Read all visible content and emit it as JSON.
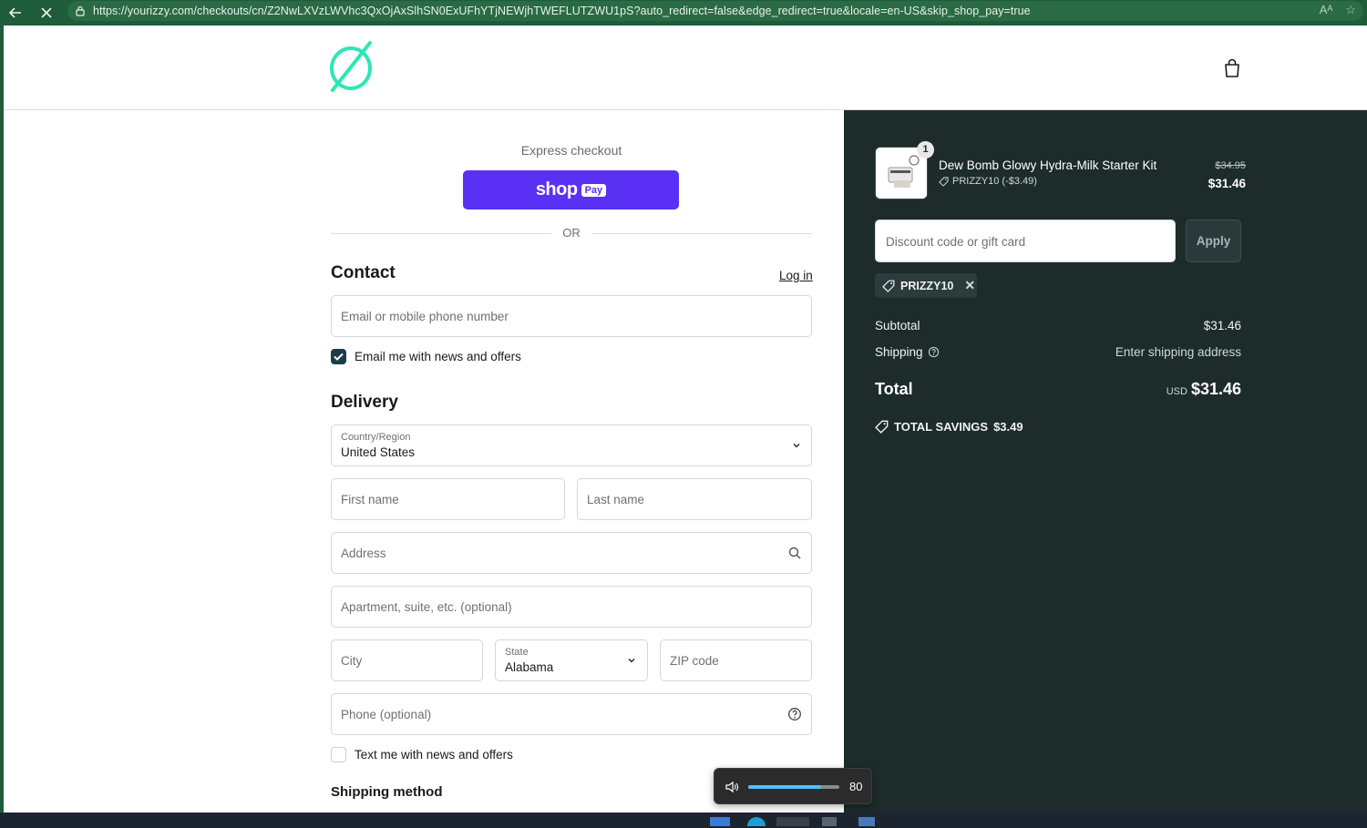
{
  "browser": {
    "url": "https://yourizzy.com/checkouts/cn/Z2NwLXVzLWVhc3QxOjAxSlhSN0ExUFhYTjNEWjhTWEFLUTZWU1pS?auto_redirect=false&edge_redirect=true&locale=en-US&skip_shop_pay=true",
    "back_icon": "back-arrow-icon",
    "stop_icon": "close-icon"
  },
  "header": {
    "logo_icon": "izzy-logo",
    "bag_icon": "shopping-bag-icon"
  },
  "express": {
    "label": "Express checkout",
    "shop_pay_text": "shop",
    "shop_pay_badge": "Pay",
    "or_text": "OR"
  },
  "contact": {
    "title": "Contact",
    "login_label": "Log in",
    "email_placeholder": "Email or mobile phone number",
    "newsletter_label": "Email me with news and offers",
    "newsletter_checked": true
  },
  "delivery": {
    "title": "Delivery",
    "country_label": "Country/Region",
    "country_value": "United States",
    "first_name_placeholder": "First name",
    "last_name_placeholder": "Last name",
    "address_placeholder": "Address",
    "apartment_placeholder": "Apartment, suite, etc. (optional)",
    "city_placeholder": "City",
    "state_label": "State",
    "state_value": "Alabama",
    "zip_placeholder": "ZIP code",
    "phone_placeholder": "Phone (optional)",
    "sms_label": "Text me with news and offers",
    "sms_checked": false
  },
  "shipping_method": {
    "title": "Shipping method"
  },
  "volume_osd": {
    "value": "80",
    "level_percent": 80
  },
  "summary": {
    "product": {
      "quantity": "1",
      "name": "Dew Bomb Glowy Hydra-Milk Starter Kit",
      "discount_code": "PRIZZY10 (-$3.49)",
      "original_price": "$34.95",
      "price": "$31.46"
    },
    "discount_placeholder": "Discount code or gift card",
    "apply_label": "Apply",
    "applied_code": "PRIZZY10",
    "subtotal_label": "Subtotal",
    "subtotal_value": "$31.46",
    "shipping_label": "Shipping",
    "shipping_value": "Enter shipping address",
    "total_label": "Total",
    "currency": "USD",
    "total_value": "$31.46",
    "savings_label": "TOTAL SAVINGS",
    "savings_value": "$3.49"
  },
  "colors": {
    "accent": "#5a31f4",
    "logo": "#2ee6b6",
    "summary_bg": "#1d2b2b",
    "checkbox": "#1d3c4a"
  }
}
